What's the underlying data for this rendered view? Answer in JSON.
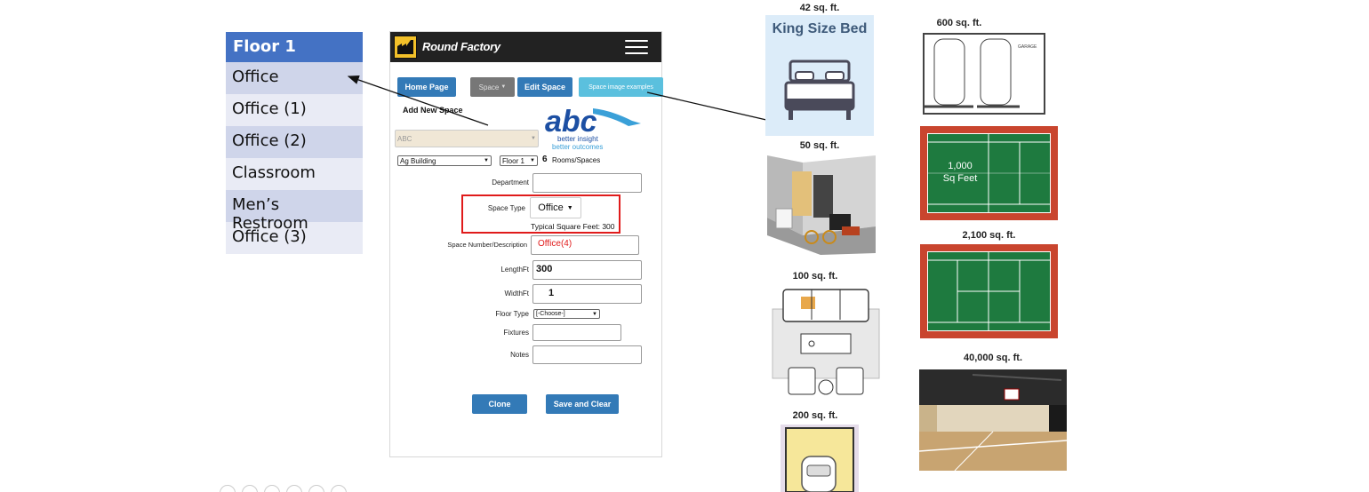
{
  "floor_panel": {
    "header": "Floor 1",
    "items": [
      "Office",
      "Office (1)",
      "Office (2)",
      "Classroom",
      "Men’s Restroom",
      "Office (3)"
    ]
  },
  "app": {
    "brand": "Round Factory",
    "buttons": {
      "home": "Home Page",
      "space": "Space",
      "edit_space": "Edit Space",
      "examples": "Space image examples"
    },
    "add_new_space": "Add New Space",
    "client_select": "ABC",
    "building_select": "Ag Building",
    "floor_select": "Floor 1",
    "room_count": "6",
    "rooms_label": "Rooms/Spaces",
    "logo": {
      "text": "abc",
      "tagline_1": "better insight",
      "tagline_2": "better outcomes"
    },
    "form": {
      "department_label": "Department",
      "department_value": "",
      "space_type_label": "Space Type",
      "space_type_value": "Office",
      "typical_sqft": "Typical Square Feet: 300",
      "space_number_label": "Space Number/Description",
      "space_number_value": "Office(4)",
      "length_label": "LengthFt",
      "length_value": "300",
      "width_label": "WidthFt",
      "width_value": "1",
      "floor_type_label": "Floor Type",
      "floor_type_value": "[-Choose-]",
      "fixtures_label": "Fixtures",
      "fixtures_value": "",
      "notes_label": "Notes",
      "notes_value": ""
    },
    "clone": "Clone",
    "save_clear": "Save and Clear"
  },
  "examples": {
    "bed": {
      "caption": "42 sq. ft.",
      "title": "King Size Bed"
    },
    "storage": {
      "caption": "50 sq. ft."
    },
    "living": {
      "caption": "100 sq. ft."
    },
    "parking": {
      "caption": "200 sq. ft."
    },
    "garage": {
      "caption": "600 sq. ft.",
      "label": "GARAGE"
    },
    "court1": {
      "caption": "",
      "text_1": "1,000",
      "text_2": "Sq Feet"
    },
    "court2": {
      "caption": "2,100 sq. ft."
    },
    "gym": {
      "caption": "40,000 sq. ft."
    }
  },
  "colors": {
    "floor_header": "#4472c4",
    "floor_row_dark": "#cfd5ea",
    "floor_row_light": "#e9ebf5",
    "primary_button": "#337ab7",
    "highlight": "#e01b1b",
    "court_green": "#1e7a3f",
    "court_red": "#c9452e"
  }
}
